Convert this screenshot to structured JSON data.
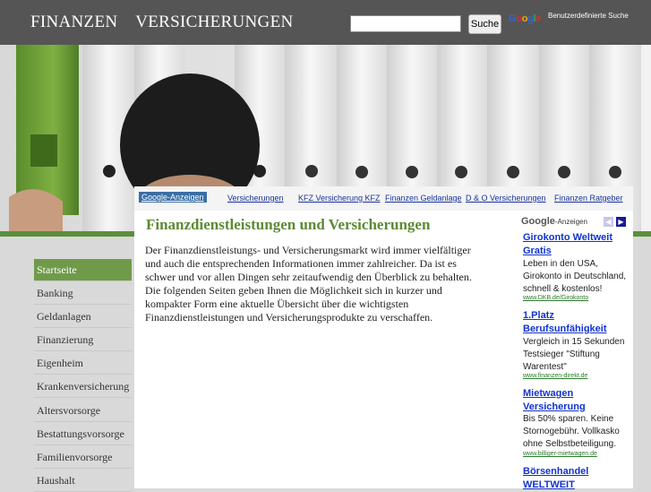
{
  "header": {
    "title": "FINANZEN    VERSICHERUNGEN",
    "search_placeholder": "",
    "search_button": "Suche",
    "google_logo": "Google",
    "custom_search_label": "Benutzerdefinierte Suche"
  },
  "colors": {
    "header_bg": "#555555",
    "accent_green": "#5b8f3b",
    "heading_green": "#5c8a35",
    "link_blue": "#1133cc"
  },
  "nav": {
    "google_ads": "Google-Anzeigen",
    "items": [
      "Versicherungen",
      "KFZ Versicherung KFZ",
      "Finanzen Geldanlage",
      "D & O Versicherungen",
      "Finanzen Ratgeber"
    ]
  },
  "sidebar": {
    "items": [
      "Startseite",
      "Banking",
      "Geldanlagen",
      "Finanzierung",
      "Eigenheim",
      "Krankenversicherung",
      "Altersvorsorge",
      "Bestattungsvorsorge",
      "Familienvorsorge",
      "Haushalt"
    ]
  },
  "main": {
    "heading": "Finanzdienstleistungen und Versicherungen",
    "text": "Der Finanzdienstleistungs- und Versicherungsmarkt wird immer vielfältiger und auch die entsprechenden Informationen immer zahlreicher. Da ist es schwer und vor allen Dingen sehr zeitaufwendig den Überblick zu behalten. Die folgenden Seiten geben Ihnen die Möglichkeit sich in kurzer und kompakter Form eine aktuelle Übersicht über die wichtigsten Finanzdienstleistungen und Versicherungsprodukte zu verschaffen."
  },
  "ads": {
    "label_google": "Google",
    "label_suffix": "-Anzeigen",
    "prev_icon": "◀",
    "next_icon": "▶",
    "items": [
      {
        "title": "Girokonto Weltweit Gratis",
        "desc": "Leben in den USA, Girokonto in Deutschland, schnell & kostenlos!",
        "url": "www.DKB.de/Girokonto"
      },
      {
        "title": "1.Platz Berufsunfähigkeit",
        "desc": "Vergleich in 15 Sekunden Testsieger \"Stiftung Warentest\"",
        "url": "www.finanzen-direkt.de"
      },
      {
        "title": "Mietwagen Versicherung",
        "desc": "Bis 50% sparen. Keine Stornogebühr. Vollkasko ohne Selbstbeteiligung.",
        "url": "www.billiger-mietwagen.de"
      },
      {
        "title": "Börsenhandel WELTWEIT",
        "desc": "",
        "url": ""
      }
    ]
  }
}
